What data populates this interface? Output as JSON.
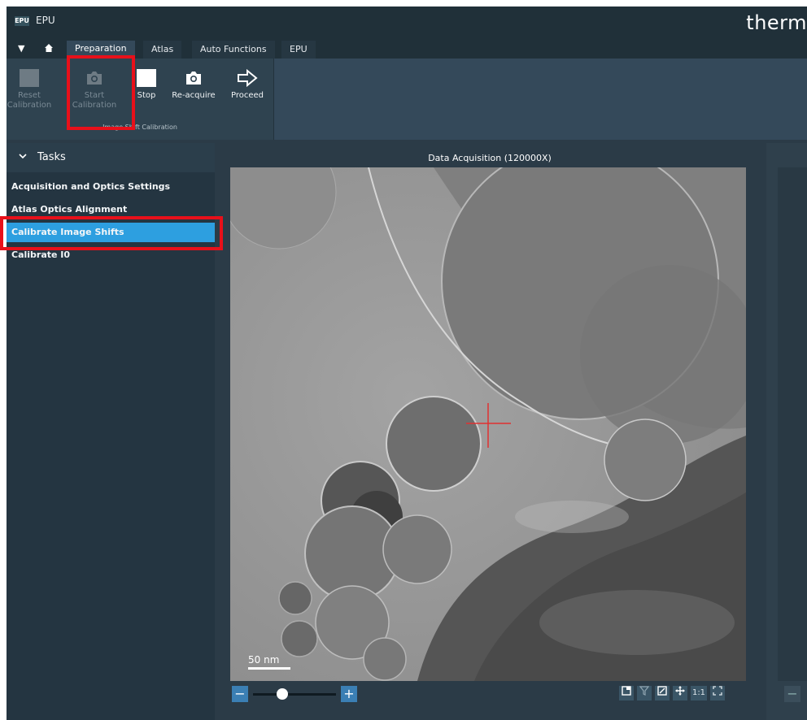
{
  "window": {
    "logo_text": "EPU",
    "title": "EPU",
    "brand": "therm"
  },
  "tabs": [
    "Preparation",
    "Atlas",
    "Auto Functions",
    "EPU"
  ],
  "ribbon": {
    "buttons": [
      {
        "line1": "Reset",
        "line2": "Calibration",
        "enabled": false
      },
      {
        "line1": "Start",
        "line2": "Calibration",
        "enabled": false
      },
      {
        "line1": "Stop",
        "line2": "",
        "enabled": true
      },
      {
        "line1": "Re-acquire",
        "line2": "",
        "enabled": true
      },
      {
        "line1": "Proceed",
        "line2": "",
        "enabled": true
      }
    ],
    "group_caption": "Image Shift Calibration"
  },
  "tasks": {
    "header": "Tasks",
    "items": [
      "Acquisition and Optics Settings",
      "Atlas Optics Alignment",
      "Calibrate Image Shifts",
      "Calibrate I0"
    ],
    "selected_index": 2
  },
  "viewer": {
    "title": "Data Acquisition (120000X)",
    "scale_label": "50 nm",
    "zoom_minus": "−",
    "zoom_plus": "+",
    "zoom_level": 0.35,
    "tool_one_to_one": "1:1"
  },
  "colors": {
    "accent": "#2d9fe0",
    "highlight": "#e8101a",
    "crosshair": "#e03030"
  }
}
